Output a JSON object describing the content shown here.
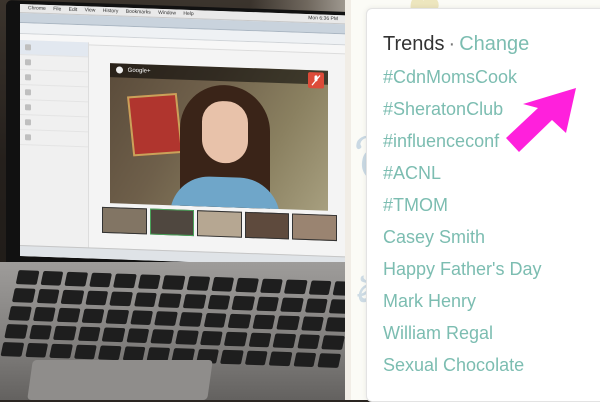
{
  "screen": {
    "menubar": [
      "Chrome",
      "File",
      "Edit",
      "View",
      "History",
      "Bookmarks",
      "Window",
      "Help"
    ],
    "clock": "Mon 6:36 PM",
    "video_app": "Google+"
  },
  "trends_panel": {
    "title": "Trends",
    "separator": "·",
    "change_link": "Change",
    "items": [
      "#CdnMomsCook",
      "#SheratonClub",
      "#influenceconf",
      "#ACNL",
      "#TMOM",
      "Casey Smith",
      "Happy Father's Day",
      "Mark Henry",
      "William Regal",
      "Sexual Chocolate"
    ],
    "highlighted_item_index": 2
  },
  "colors": {
    "trend_link": "#7cbdb1",
    "title_text": "#333333",
    "arrow": "#ff20dc",
    "hangout_mic": "#dd4b39"
  },
  "icons": {
    "arrow": "magenta-arrow-icon",
    "mic": "mic-muted-icon"
  }
}
